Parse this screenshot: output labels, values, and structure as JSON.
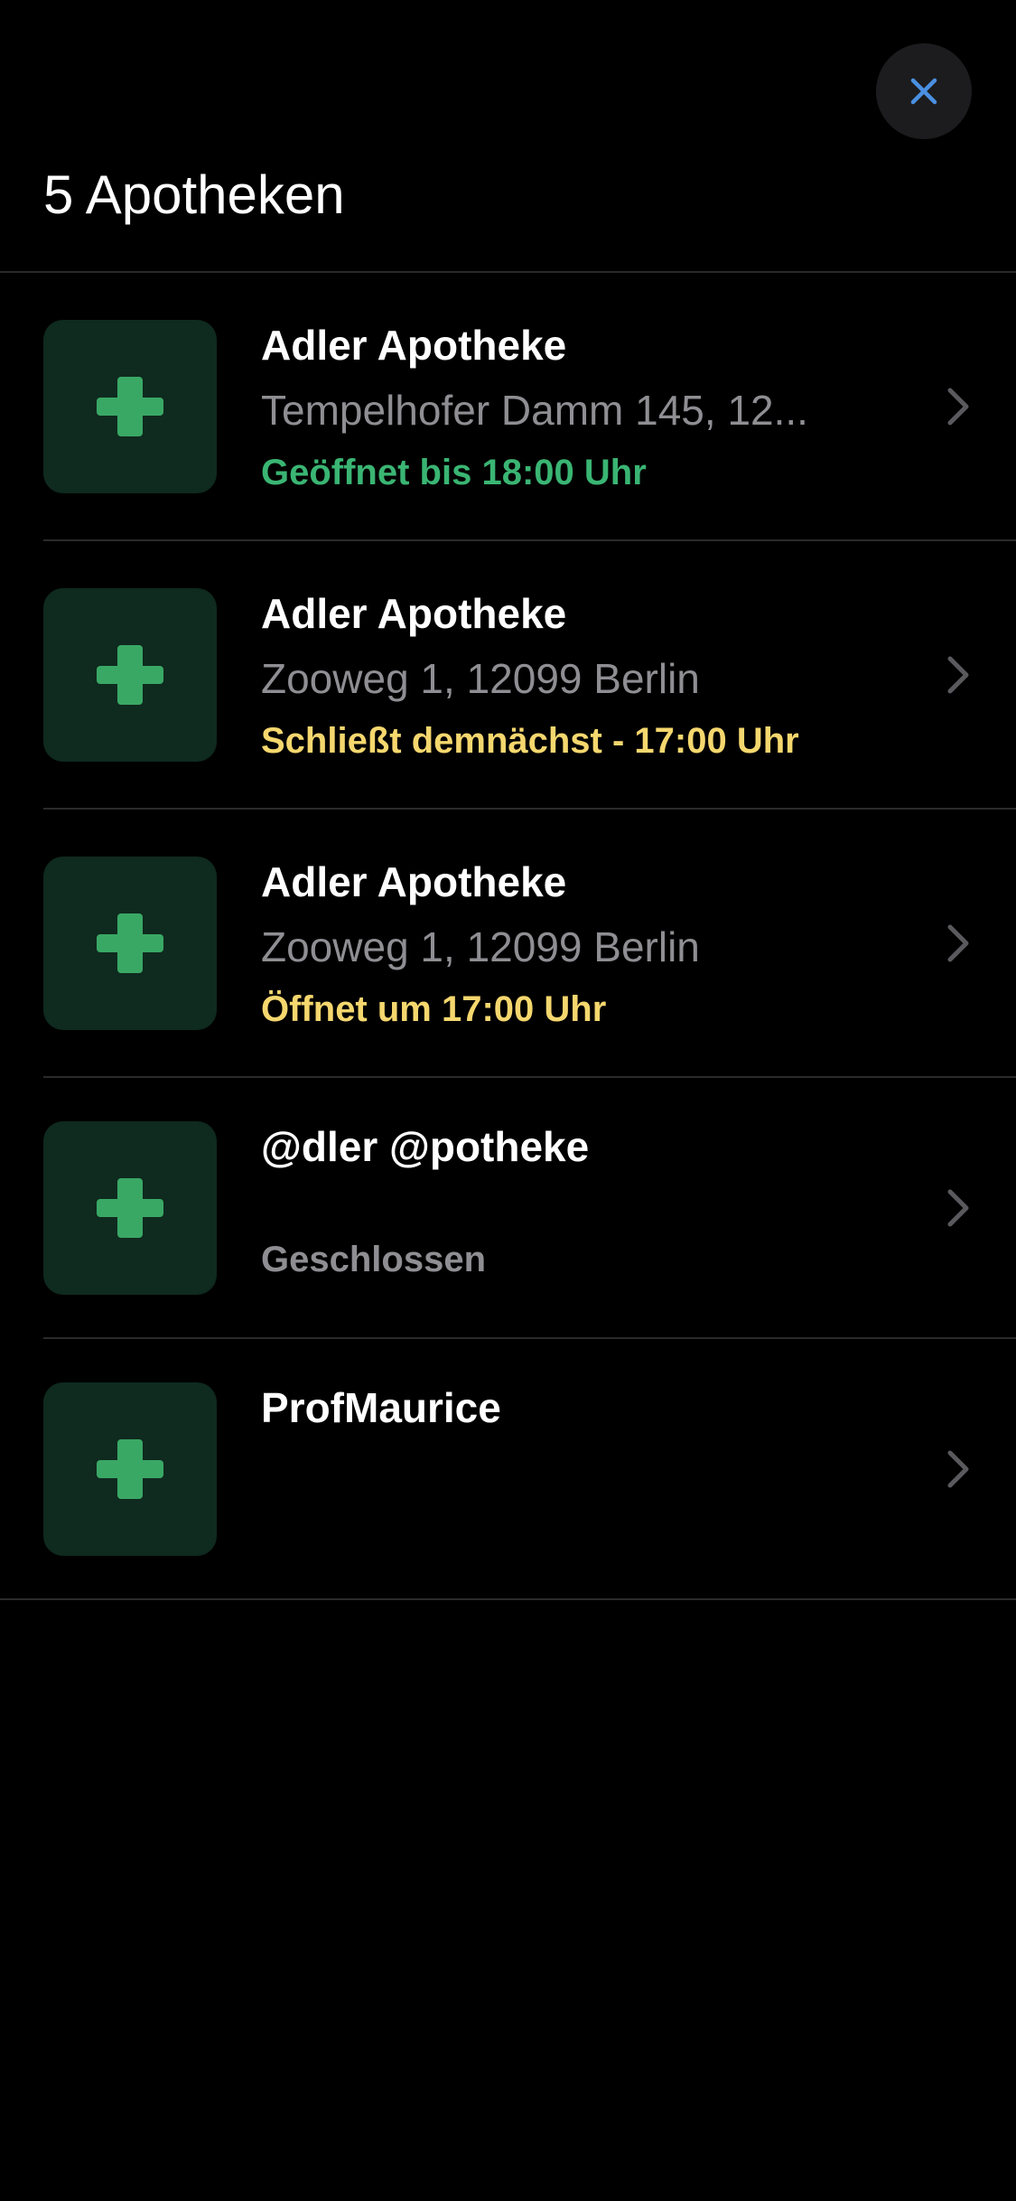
{
  "header": {
    "title": "5 Apotheken",
    "close_icon": "close-icon"
  },
  "colors": {
    "background": "#000000",
    "accent_blue": "#4a90e2",
    "thumb_bg": "#0f2a1f",
    "cross_green": "#3aa865",
    "status_open": "#3ab573",
    "status_warning": "#f5d76e",
    "status_closed": "#8e8e93",
    "secondary_text": "#8e8e93"
  },
  "pharmacies": [
    {
      "name": "Adler Apotheke",
      "address": "Tempelhofer Damm 145, 12...",
      "status": "Geöffnet bis 18:00 Uhr",
      "status_kind": "open",
      "icon": "pharmacy-cross-icon"
    },
    {
      "name": "Adler Apotheke",
      "address": "Zooweg 1, 12099 Berlin",
      "status": "Schließt demnächst - 17:00 Uhr",
      "status_kind": "warning",
      "icon": "pharmacy-cross-icon"
    },
    {
      "name": "Adler Apotheke",
      "address": "Zooweg 1, 12099 Berlin",
      "status": "Öffnet um 17:00 Uhr",
      "status_kind": "warning",
      "icon": "pharmacy-cross-icon"
    },
    {
      "name": "@dler @potheke",
      "address": "",
      "status": "Geschlossen",
      "status_kind": "closed",
      "icon": "pharmacy-cross-icon"
    },
    {
      "name": "ProfMaurice",
      "address": "",
      "status": "",
      "status_kind": "none",
      "icon": "pharmacy-cross-icon"
    }
  ]
}
